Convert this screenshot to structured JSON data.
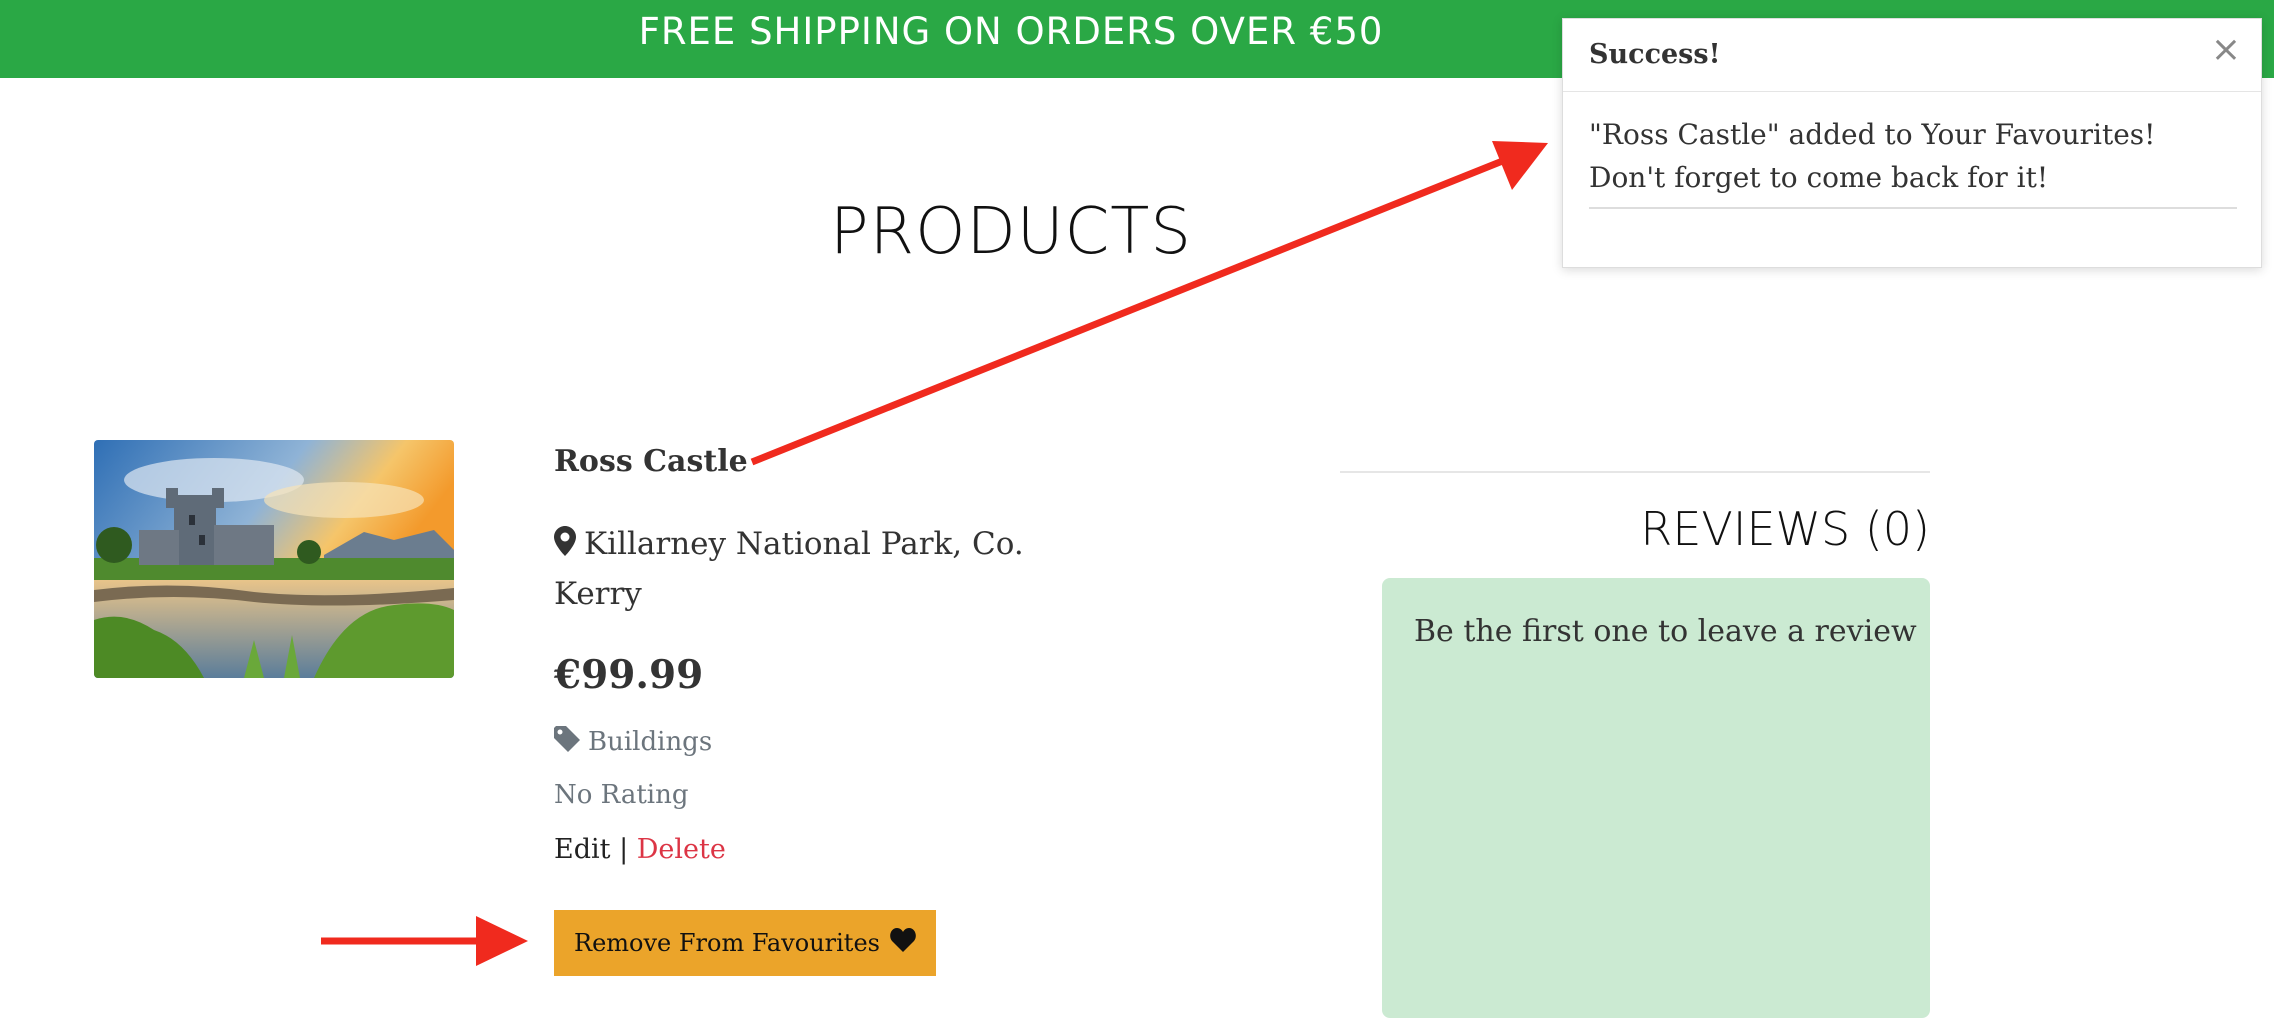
{
  "banner": {
    "text": "FREE SHIPPING ON ORDERS OVER €50"
  },
  "page": {
    "title": "PRODUCTS"
  },
  "product": {
    "name": "Ross Castle",
    "location": "Killarney National Park, Co. Kerry",
    "price": "€99.99",
    "category": "Buildings",
    "rating": "No Rating",
    "edit_label": "Edit",
    "separator": "|",
    "delete_label": "Delete",
    "favourite_button_label": "Remove From Favourites"
  },
  "reviews": {
    "title": "REVIEWS (0)",
    "empty_message": "Be the first one to leave a review"
  },
  "toast": {
    "title": "Success!",
    "close": "×",
    "message": "\"Ross Castle\" added to Your Favourites! Don't forget to come back for it!"
  },
  "icons": {
    "location": "map-marker-icon",
    "category": "tag-icon",
    "favourite": "heart-icon",
    "close": "close-icon"
  },
  "colors": {
    "banner": "#2aa845",
    "button": "#eba42a",
    "delete": "#dc3545",
    "reviews_box": "#cbead2",
    "annotation_arrow": "#f02a1e"
  }
}
